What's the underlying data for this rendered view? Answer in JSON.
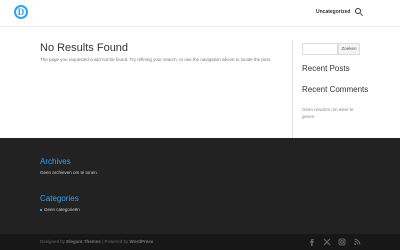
{
  "header": {
    "logo_letter": "D",
    "nav_link": "Uncategorized",
    "search_icon": "search-icon"
  },
  "main": {
    "title": "No Results Found",
    "message": "The page you requested could not be found. Try refining your search, or use the navigation above to locate the post."
  },
  "sidebar": {
    "search_placeholder": "",
    "search_button": "Zoeken",
    "recent_posts_heading": "Recent Posts",
    "recent_comments_heading": "Recent Comments",
    "recent_comments_text": "Geen reacties om weer te geven."
  },
  "footer": {
    "archives_heading": "Archives",
    "archives_text": "Geen archieven om te tonen.",
    "categories_heading": "Categories",
    "categories_item": "Geen categorieën"
  },
  "bottom_bar": {
    "designed_by": "Designed by",
    "elegant": "Elegant Themes",
    "sep": "| Powered by",
    "wordpress": "WordPress",
    "social": [
      "facebook-icon",
      "x-icon",
      "instagram-icon",
      "rss-icon"
    ]
  },
  "colors": {
    "accent": "#2ea3f2",
    "footer_bg": "#222222",
    "bottom_bg": "#171717"
  }
}
